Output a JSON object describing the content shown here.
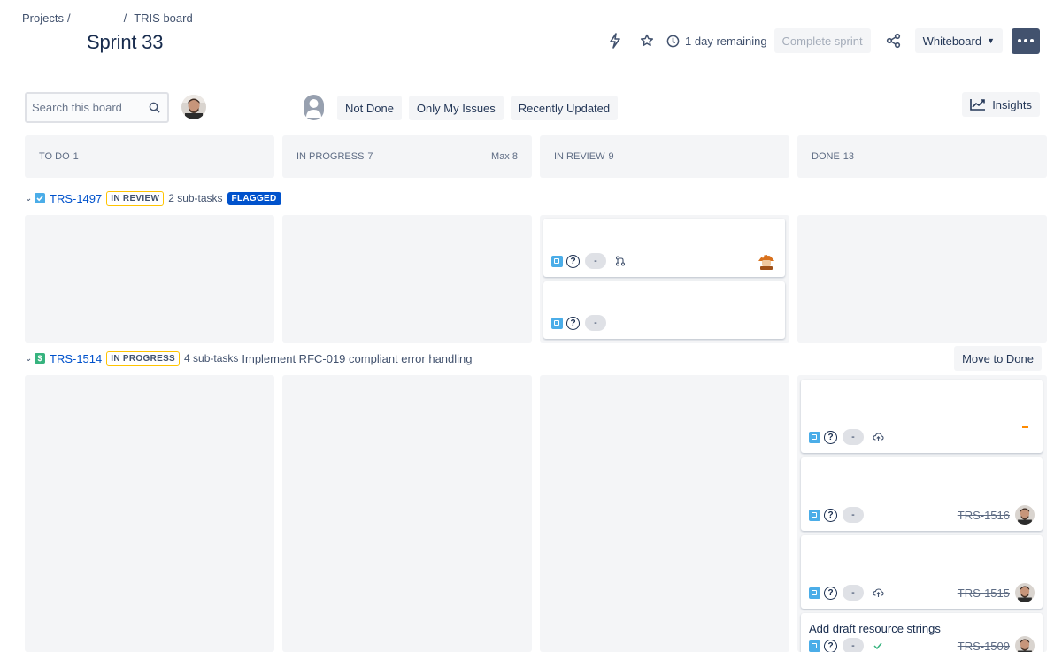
{
  "breadcrumb": {
    "projects": "Projects",
    "sep1": "/",
    "sep2": "/",
    "board": "TRIS board"
  },
  "page_title": "Sprint 33",
  "header": {
    "remaining": "1 day remaining",
    "complete_sprint": "Complete sprint",
    "view_select": "Whiteboard"
  },
  "filters": {
    "search_placeholder": "Search this board",
    "quick_filters": [
      "Not Done",
      "Only My Issues",
      "Recently Updated"
    ],
    "insights": "Insights"
  },
  "columns": [
    {
      "name": "TO DO",
      "count": "1",
      "max": ""
    },
    {
      "name": "IN PROGRESS",
      "count": "7",
      "max": "Max 8"
    },
    {
      "name": "IN REVIEW",
      "count": "9",
      "max": ""
    },
    {
      "name": "DONE",
      "count": "13",
      "max": ""
    }
  ],
  "swimlanes": [
    {
      "key": "TRS-1497",
      "status": "IN REVIEW",
      "subtasks": "2 sub-tasks",
      "flag": "FLAGGED",
      "summary": ""
    },
    {
      "key": "TRS-1514",
      "status": "IN PROGRESS",
      "subtasks": "4 sub-tasks",
      "summary": "Implement RFC-019 compliant error handling",
      "action": "Move to Done"
    }
  ],
  "cards": {
    "estimate": "-",
    "question": "?",
    "done_parent_1": "TRS-1516",
    "done_parent_2": "TRS-1515",
    "done_parent_3": "TRS-1509",
    "done_card_4_title": "Add draft resource strings"
  },
  "colors": {
    "accent": "#0052cc",
    "column_bg": "#f4f5f7",
    "subtask_blue": "#4bade8",
    "story_green": "#36b37e",
    "task_blue": "#4bade8",
    "more_button": "#42526e"
  }
}
